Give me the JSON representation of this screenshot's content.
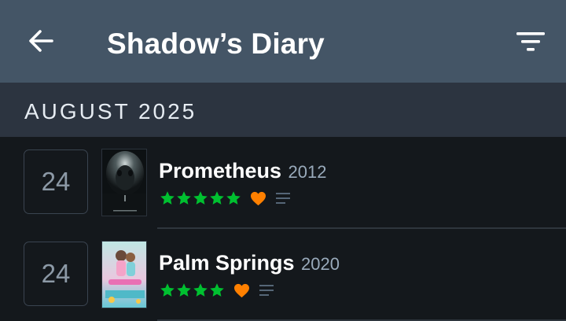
{
  "appbar": {
    "title": "Shadow’s Diary",
    "back_icon": "arrow-left-icon",
    "filter_icon": "filter-icon"
  },
  "section": {
    "label": "AUGUST 2025"
  },
  "colors": {
    "appbar_bg": "#445566",
    "section_bg": "#2c3440",
    "page_bg": "#14181c",
    "star_green": "#00c030",
    "heart_orange": "#ff8000"
  },
  "entries": [
    {
      "day": "24",
      "title": "Prometheus",
      "year": "2012",
      "rating_stars": 5,
      "liked": true,
      "has_review": true,
      "poster_icon": "prometheus-poster"
    },
    {
      "day": "24",
      "title": "Palm Springs",
      "year": "2020",
      "rating_stars": 4,
      "liked": true,
      "has_review": true,
      "poster_icon": "palm-springs-poster"
    }
  ]
}
